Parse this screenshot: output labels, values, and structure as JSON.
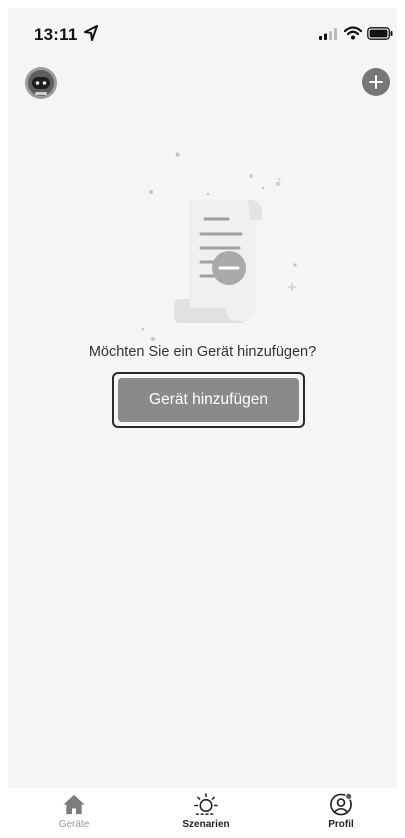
{
  "status_bar": {
    "time": "13:11",
    "icons": [
      "location-arrow-icon",
      "cellular-signal-icon",
      "wifi-icon",
      "battery-icon"
    ]
  },
  "header": {
    "avatar_icon": "robot-avatar-icon",
    "add_icon": "plus-circle-icon"
  },
  "empty_state": {
    "illustration": "document-scroll-illustration",
    "prompt": "Möchten Sie ein Gerät hinzufügen?",
    "button_label": "Gerät hinzufügen"
  },
  "tabs": [
    {
      "label": "Geräte",
      "icon": "home-icon",
      "active": false
    },
    {
      "label": "Szenarien",
      "icon": "sun-icon",
      "active": true
    },
    {
      "label": "Profil",
      "icon": "profile-icon",
      "active": true
    }
  ],
  "colors": {
    "background": "#f5f5f5",
    "button": "#8a8a8a",
    "button_outline": "#2a2a2a",
    "inactive_tab": "#9a9a9a"
  }
}
